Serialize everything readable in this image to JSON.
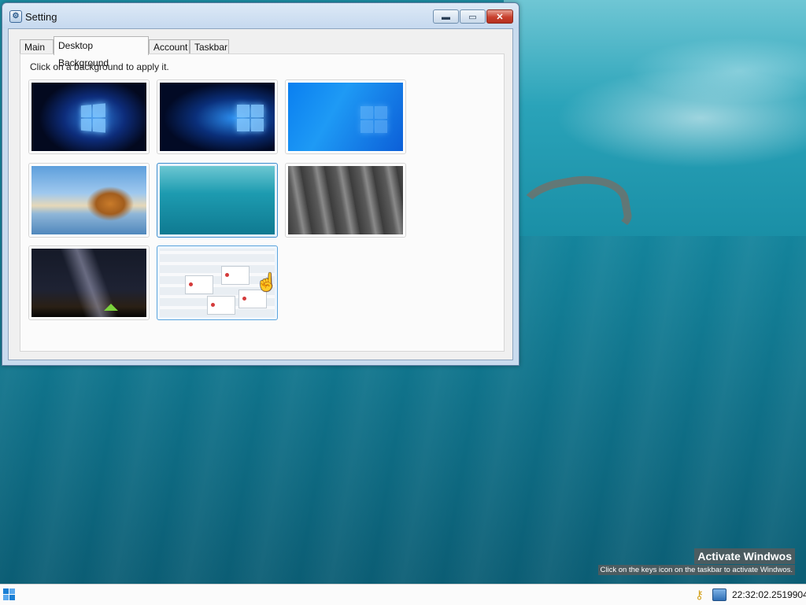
{
  "window": {
    "title": "Setting",
    "icon": "settings-app-icon",
    "controls": {
      "minimize": "▬",
      "maximize": "▭",
      "close": "✕"
    }
  },
  "tabs": [
    {
      "label": "Main",
      "active": false
    },
    {
      "label": "Desktop Background",
      "active": true
    },
    {
      "label": "Account",
      "active": false
    },
    {
      "label": "Taskbar",
      "active": false
    }
  ],
  "desktop_background": {
    "instruction": "Click on a background to apply it.",
    "thumbnails": [
      {
        "name": "windows-10-dark-logo",
        "state": "normal"
      },
      {
        "name": "windows-10-hero-logo",
        "state": "normal"
      },
      {
        "name": "windows-10-blue",
        "state": "normal"
      },
      {
        "name": "beach-rocks",
        "state": "normal"
      },
      {
        "name": "ocean-underwater",
        "state": "selected"
      },
      {
        "name": "rock-cliff",
        "state": "normal"
      },
      {
        "name": "milky-way-tent",
        "state": "normal"
      },
      {
        "name": "dialog-boxes",
        "state": "hovered"
      }
    ]
  },
  "watermark": {
    "title": "Activate Windwos",
    "subtitle": "Click on the keys icon on the taskbar to activate Windwos."
  },
  "taskbar": {
    "start_icon": "windows-start-icon",
    "tray_icons": [
      "keys-icon",
      "network-icon"
    ],
    "clock": "22:32:02.2519904"
  },
  "colors": {
    "selection_border": "#3f8fcf",
    "close_button": "#c8402d",
    "desktop_water": "#14849c"
  }
}
